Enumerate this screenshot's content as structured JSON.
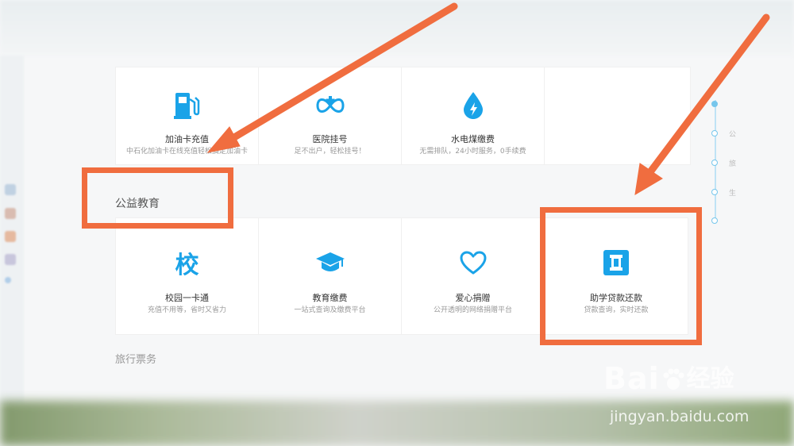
{
  "section_public_welfare": "公益教育",
  "section_travel": "旅行票务",
  "row_top": [
    {
      "title": "加油卡充值",
      "subtitle": "中石化加油卡在线充值轻松搞定加油卡",
      "icon": "gas-pump-icon"
    },
    {
      "title": "医院挂号",
      "subtitle": "足不出户，轻松挂号！",
      "icon": "medical-cross-icon"
    },
    {
      "title": "水电煤缴费",
      "subtitle": "无需排队，24小时服务，0手续费",
      "icon": "water-drop-bolt-icon"
    },
    {
      "title": "",
      "subtitle": "",
      "icon": ""
    }
  ],
  "row_education": [
    {
      "title": "校园一卡通",
      "subtitle": "充值不用等，省时又省力",
      "icon": "school-char-icon",
      "glyph": "校"
    },
    {
      "title": "教育缴费",
      "subtitle": "一站式查询及缴费平台",
      "icon": "graduation-cap-icon"
    },
    {
      "title": "爱心捐赠",
      "subtitle": "公开透明的网络捐赠平台",
      "icon": "heart-icon"
    },
    {
      "title": "助学贷款还款",
      "subtitle": "贷款查询，实时还款",
      "icon": "loan-frame-icon"
    }
  ],
  "timeline_labels": [
    "公",
    "旅",
    "生"
  ],
  "watermark": {
    "brand": "Bai",
    "brand_cn": "经验",
    "url": "jingyan.baidu.com"
  },
  "colors": {
    "accent_blue": "#1aa3e8",
    "annotation_orange": "#f06d3f"
  }
}
